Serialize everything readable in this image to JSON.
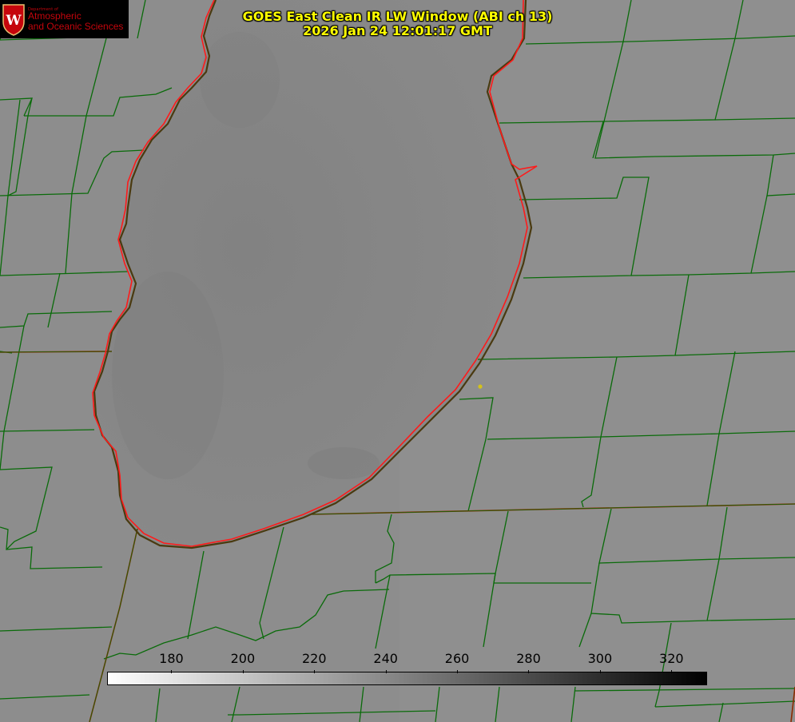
{
  "logo": {
    "department": "Department of",
    "name_line1": "Atmospheric",
    "name_line2": "and Oceanic Sciences",
    "seal_letter": "W"
  },
  "title": {
    "line1": "GOES East Clean IR LW Window (ABI ch 13)",
    "line2": "2026 Jan 24 12:01:17 GMT"
  },
  "colorbar": {
    "ticks": [
      "180",
      "200",
      "220",
      "240",
      "260",
      "280",
      "300",
      "320"
    ],
    "range": [
      162,
      330
    ],
    "gradient": [
      "#ffffff",
      "#000000"
    ]
  },
  "colors": {
    "background": "#8e8e8e",
    "lake": "#878787",
    "county_lines": "#0a6b0a",
    "state_lines": "#8b2a00",
    "coastline": "#ff1a1a",
    "marker": "#d4c21a",
    "title_text": "#ffff00"
  }
}
